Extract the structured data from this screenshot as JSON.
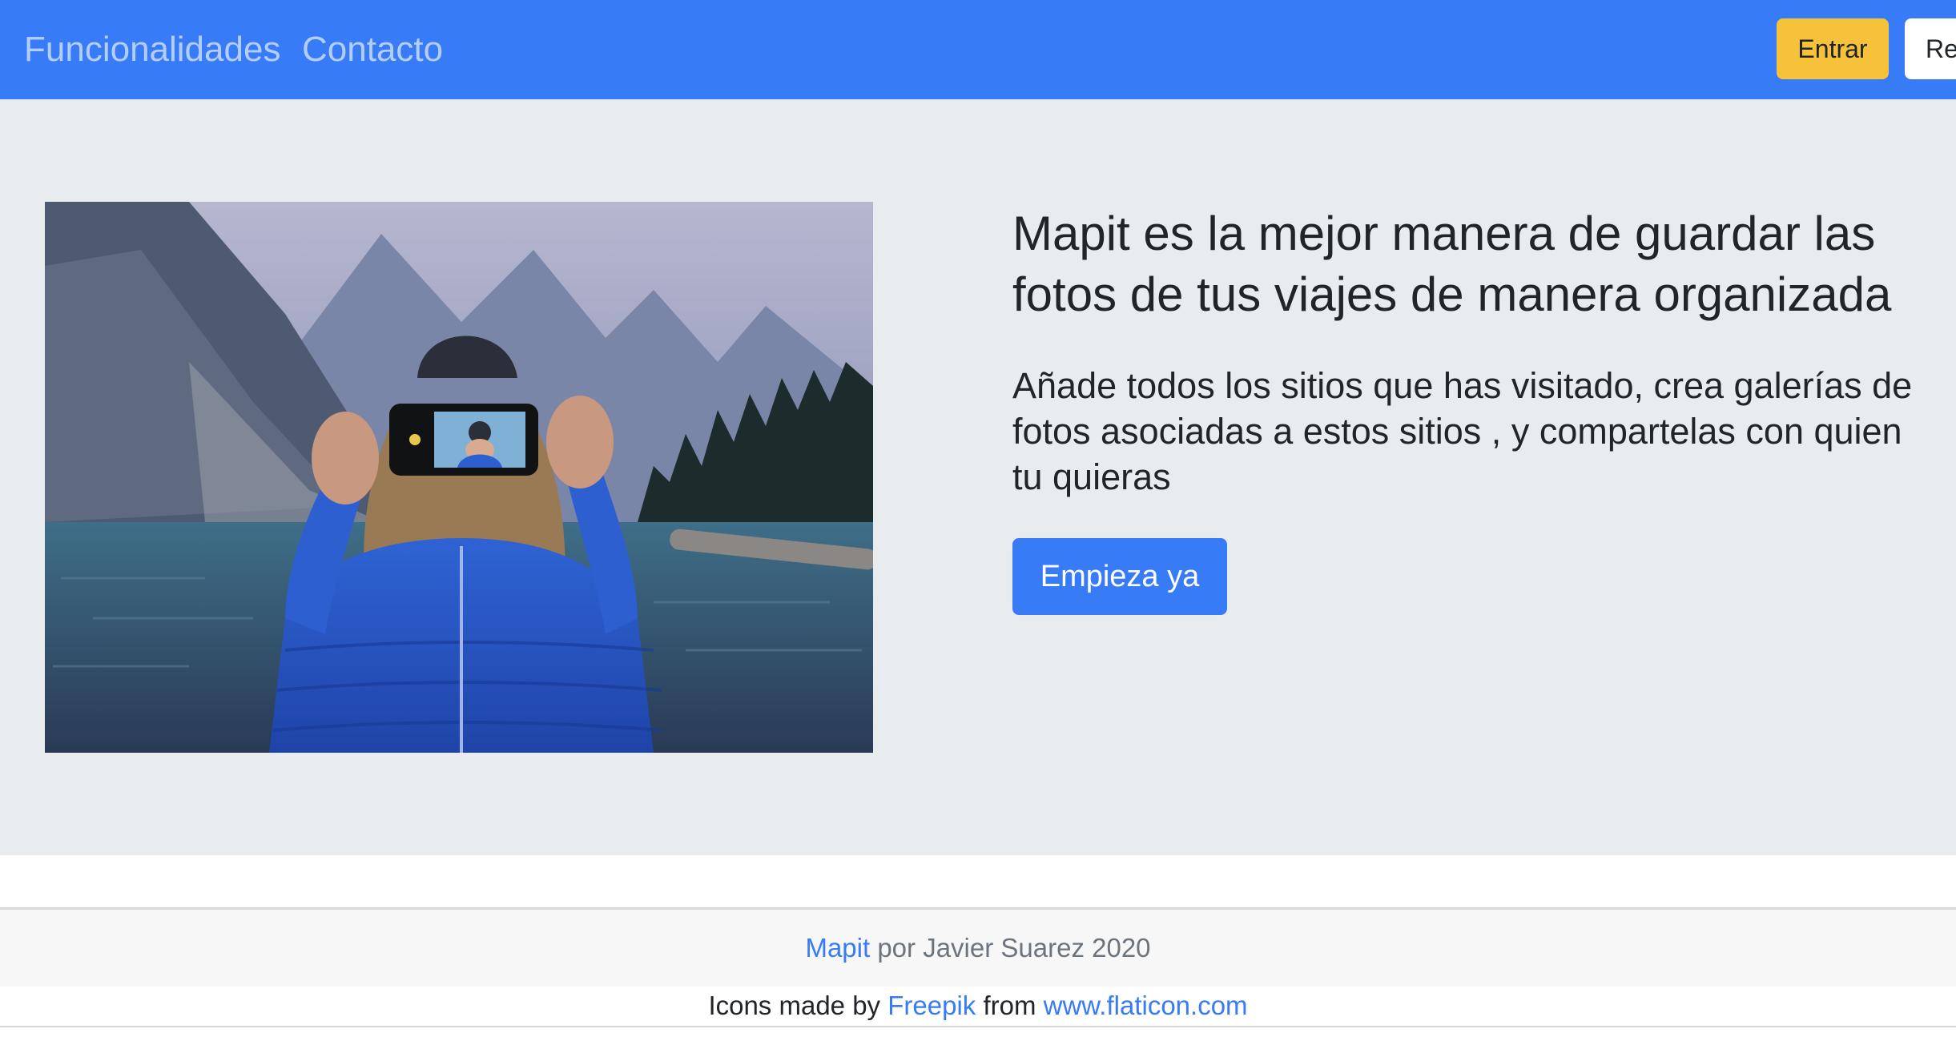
{
  "navbar": {
    "links": [
      "Funcionalidades",
      "Contacto"
    ],
    "login_label": "Entrar",
    "register_label": "Re",
    "background": "#377bf6",
    "login_color": "#f6c23a"
  },
  "hero": {
    "title": "Mapit es la mejor manera de guardar las fotos de tus viajes de manera organizada",
    "subtitle": "Añade todos los sitios que has visitado, crea galerías de fotos asociadas a estos sitios , y compartelas con quien tu quieras",
    "cta_label": "Empieza ya",
    "background": "#e9ecef"
  },
  "footer": {
    "brand": "Mapit",
    "byline": "por Javier Suarez 2020",
    "credits_prefix": "Icons made by",
    "credits_author": "Freepik",
    "credits_middle": "from",
    "credits_site": "www.flaticon.com"
  }
}
